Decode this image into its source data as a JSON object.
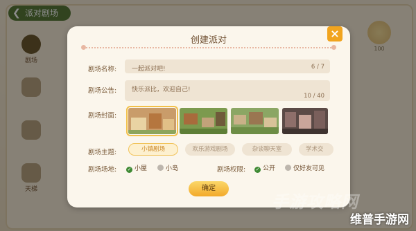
{
  "background": {
    "back_label": "派对剧场",
    "nav_items": [
      "剧场",
      "",
      "",
      "天梯"
    ],
    "coin_label": "100"
  },
  "dialog": {
    "title": "创建派对",
    "close_icon": "×",
    "fields": {
      "name_label": "剧场名称:",
      "name_value": "一起派对吧!",
      "name_count": "6 / 7",
      "notice_label": "剧场公告:",
      "notice_value": "快乐派比，欢迎自己!",
      "notice_count": "10 / 40",
      "cover_label": "剧场封面:",
      "theme_label": "剧场主题:",
      "venue_label": "剧场场地:",
      "permission_label": "剧场权限:"
    },
    "themes": [
      "小镇剧场",
      "欢乐游戏剧场",
      "杂谈聊天室",
      "学术交"
    ],
    "selected_theme_index": 0,
    "selected_cover_index": 0,
    "venue_options": [
      {
        "label": "小屋",
        "checked": true
      },
      {
        "label": "小岛",
        "checked": false
      }
    ],
    "permission_options": [
      {
        "label": "公开",
        "checked": true
      },
      {
        "label": "仅好友可见",
        "checked": false
      }
    ],
    "confirm_label": "确定"
  },
  "watermark": {
    "text": "维普手游网",
    "logo_text": "手游攻略网"
  }
}
